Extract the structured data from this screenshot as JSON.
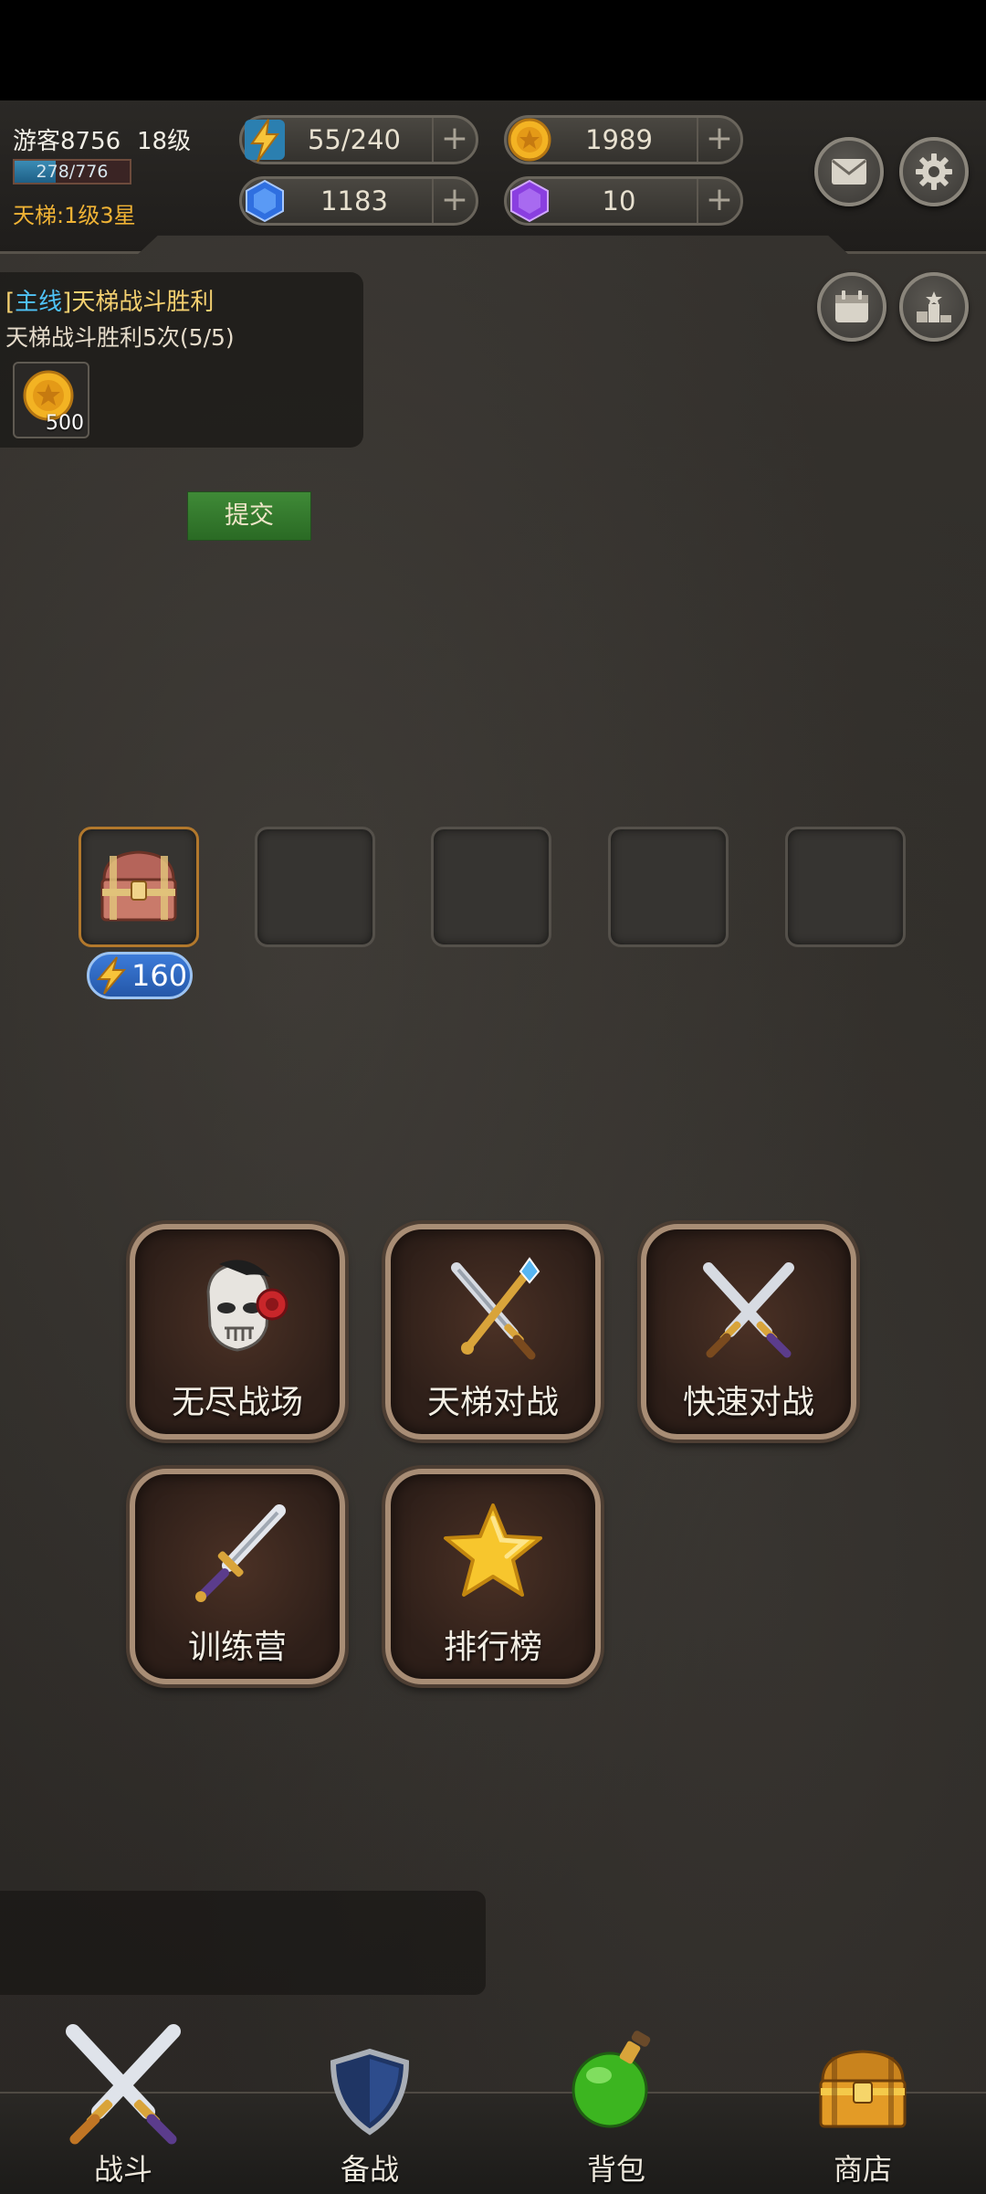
{
  "player": {
    "name": "游客8756",
    "level": "18级",
    "xp_text": "278/776",
    "xp_fraction": 0.358,
    "ladder_rank": "天梯:1级3星"
  },
  "resources": {
    "energy": "55/240",
    "gold": "1989",
    "gems": "1183",
    "crystals": "10",
    "plus": "+"
  },
  "quest": {
    "tag": "主线",
    "title": "天梯战斗胜利",
    "description": "天梯战斗胜利5次(5/5)",
    "reward_amount": "500",
    "submit_label": "提交"
  },
  "chest": {
    "energy_cost": "160"
  },
  "modes": {
    "endless": "无尽战场",
    "ladder": "天梯对战",
    "quick": "快速对战",
    "training": "训练营",
    "ranking": "排行榜"
  },
  "nav": {
    "battle": "战斗",
    "prepare": "备战",
    "bag": "背包",
    "shop": "商店"
  },
  "colors": {
    "quest_tag": "#4fc3f7",
    "quest_title": "#f4d070",
    "ladder_rank": "#f0b335",
    "submit_button": "#3f8a37"
  }
}
